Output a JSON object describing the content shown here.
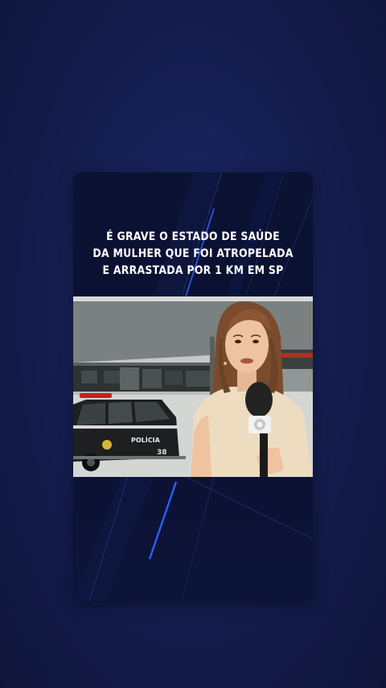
{
  "headline": {
    "lines": [
      "É GRAVE O ESTADO DE SAÚDE",
      "DA MULHER QUE FOI ATROPELADA",
      "E ARRASTADA POR 1 KM EM SP"
    ]
  },
  "video": {
    "car_text": "POLÍCIA",
    "car_number": "38"
  },
  "colors": {
    "background": "#141c4c",
    "card": "#0b1233",
    "accent_line": "#2f63ff"
  }
}
